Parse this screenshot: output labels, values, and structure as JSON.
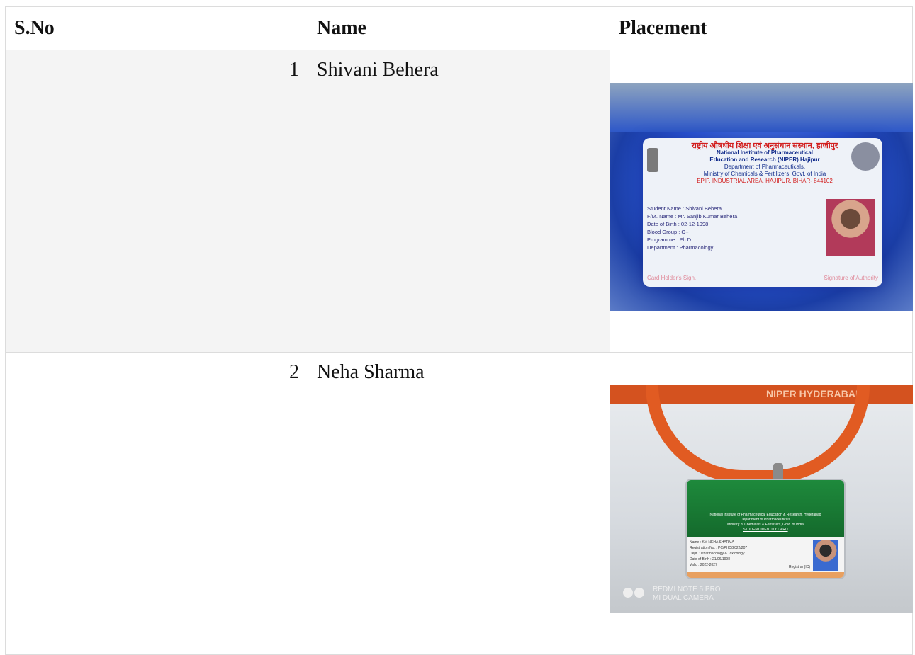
{
  "table": {
    "headers": [
      "S.No",
      "Name",
      "Placement"
    ],
    "rows": [
      {
        "sno": "1",
        "name": "Shivani Behera",
        "card": {
          "title_hindi": "राष्ट्रीय औषधीय शिक्षा एवं अनुसंधान संस्थान, हाजीपुर",
          "institute": "National Institute of Pharmaceutical",
          "institute2": "Education and Research (NIPER) Hajipur",
          "dept": "Department of Pharmaceuticals,",
          "ministry": "Ministry of Chemicals & Fertilizers, Govt. of India",
          "address": "EPIP, INDUSTRIAL AREA, HAJIPUR, BIHAR- 844102",
          "fields": [
            "Student Name : Shivani Behera",
            "F/M. Name : Mr. Sanjib Kumar Behera",
            "Date of Birth : 02-12-1998",
            "Blood Group : O+",
            "Programme : Ph.D.",
            "Department : Pharmacology"
          ],
          "holder_sign": "Card Holder's Sign.",
          "authority_sign": "Signature of Authority"
        }
      },
      {
        "sno": "2",
        "name": "Neha Sharma",
        "card": {
          "strap_text": "NIPER HYDERABAD",
          "institute": "National Institute of Pharmaceutical Education & Research, Hyderabad",
          "dept": "Department of Pharmaceuticals",
          "ministry": "Ministry of Chemicals & Fertilizers, Govt. of India",
          "card_title": "STUDENT IDENTITY CARD",
          "fields": [
            "Name : KM NEHA SHARMA",
            "Registration No. : PC/PHD/2022/207",
            "Dept. : Pharmacology & Toxicology",
            "Date of Birth : 21/06/1998",
            "Valid : 2022-2027"
          ],
          "registrar": "Registrar (IC)",
          "watermark1": "REDMI NOTE 5 PRO",
          "watermark2": "MI DUAL CAMERA"
        }
      }
    ]
  }
}
